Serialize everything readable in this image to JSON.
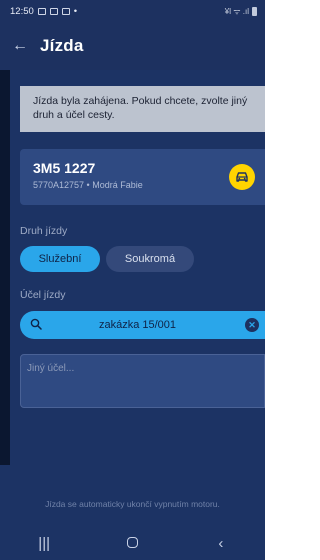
{
  "status_bar": {
    "time": "12:50",
    "left_icons": [
      "image-icon",
      "car-icon",
      "mail-icon"
    ],
    "dot": "•",
    "right_text": "¥l ᯤ .ıl"
  },
  "app_bar": {
    "back_glyph": "←",
    "title": "Jízda"
  },
  "banner": {
    "text": "Jízda byla zahájena. Pokud chcete, zvolte jiný druh a účel cesty."
  },
  "vehicle": {
    "plate": "3M5 1227",
    "detail": "5770A12757 • Modrá Fabie",
    "icon": "car-icon"
  },
  "trip_type": {
    "label": "Druh jízdy",
    "options": [
      "Služební",
      "Soukromá"
    ],
    "selected": "Služební"
  },
  "purpose": {
    "label": "Účel jízdy",
    "search_value": "zakázka 15/001",
    "clear_glyph": "✕",
    "other_placeholder": "Jiný účel..."
  },
  "footer_note": "Jízda se automaticky ukončí vypnutím motoru.",
  "nav": {
    "recent": "|||",
    "back": "‹"
  },
  "colors": {
    "background": "#1c3364",
    "accent": "#2aa6ea",
    "car_button": "#ffd400",
    "banner": "#bcc3cf"
  }
}
